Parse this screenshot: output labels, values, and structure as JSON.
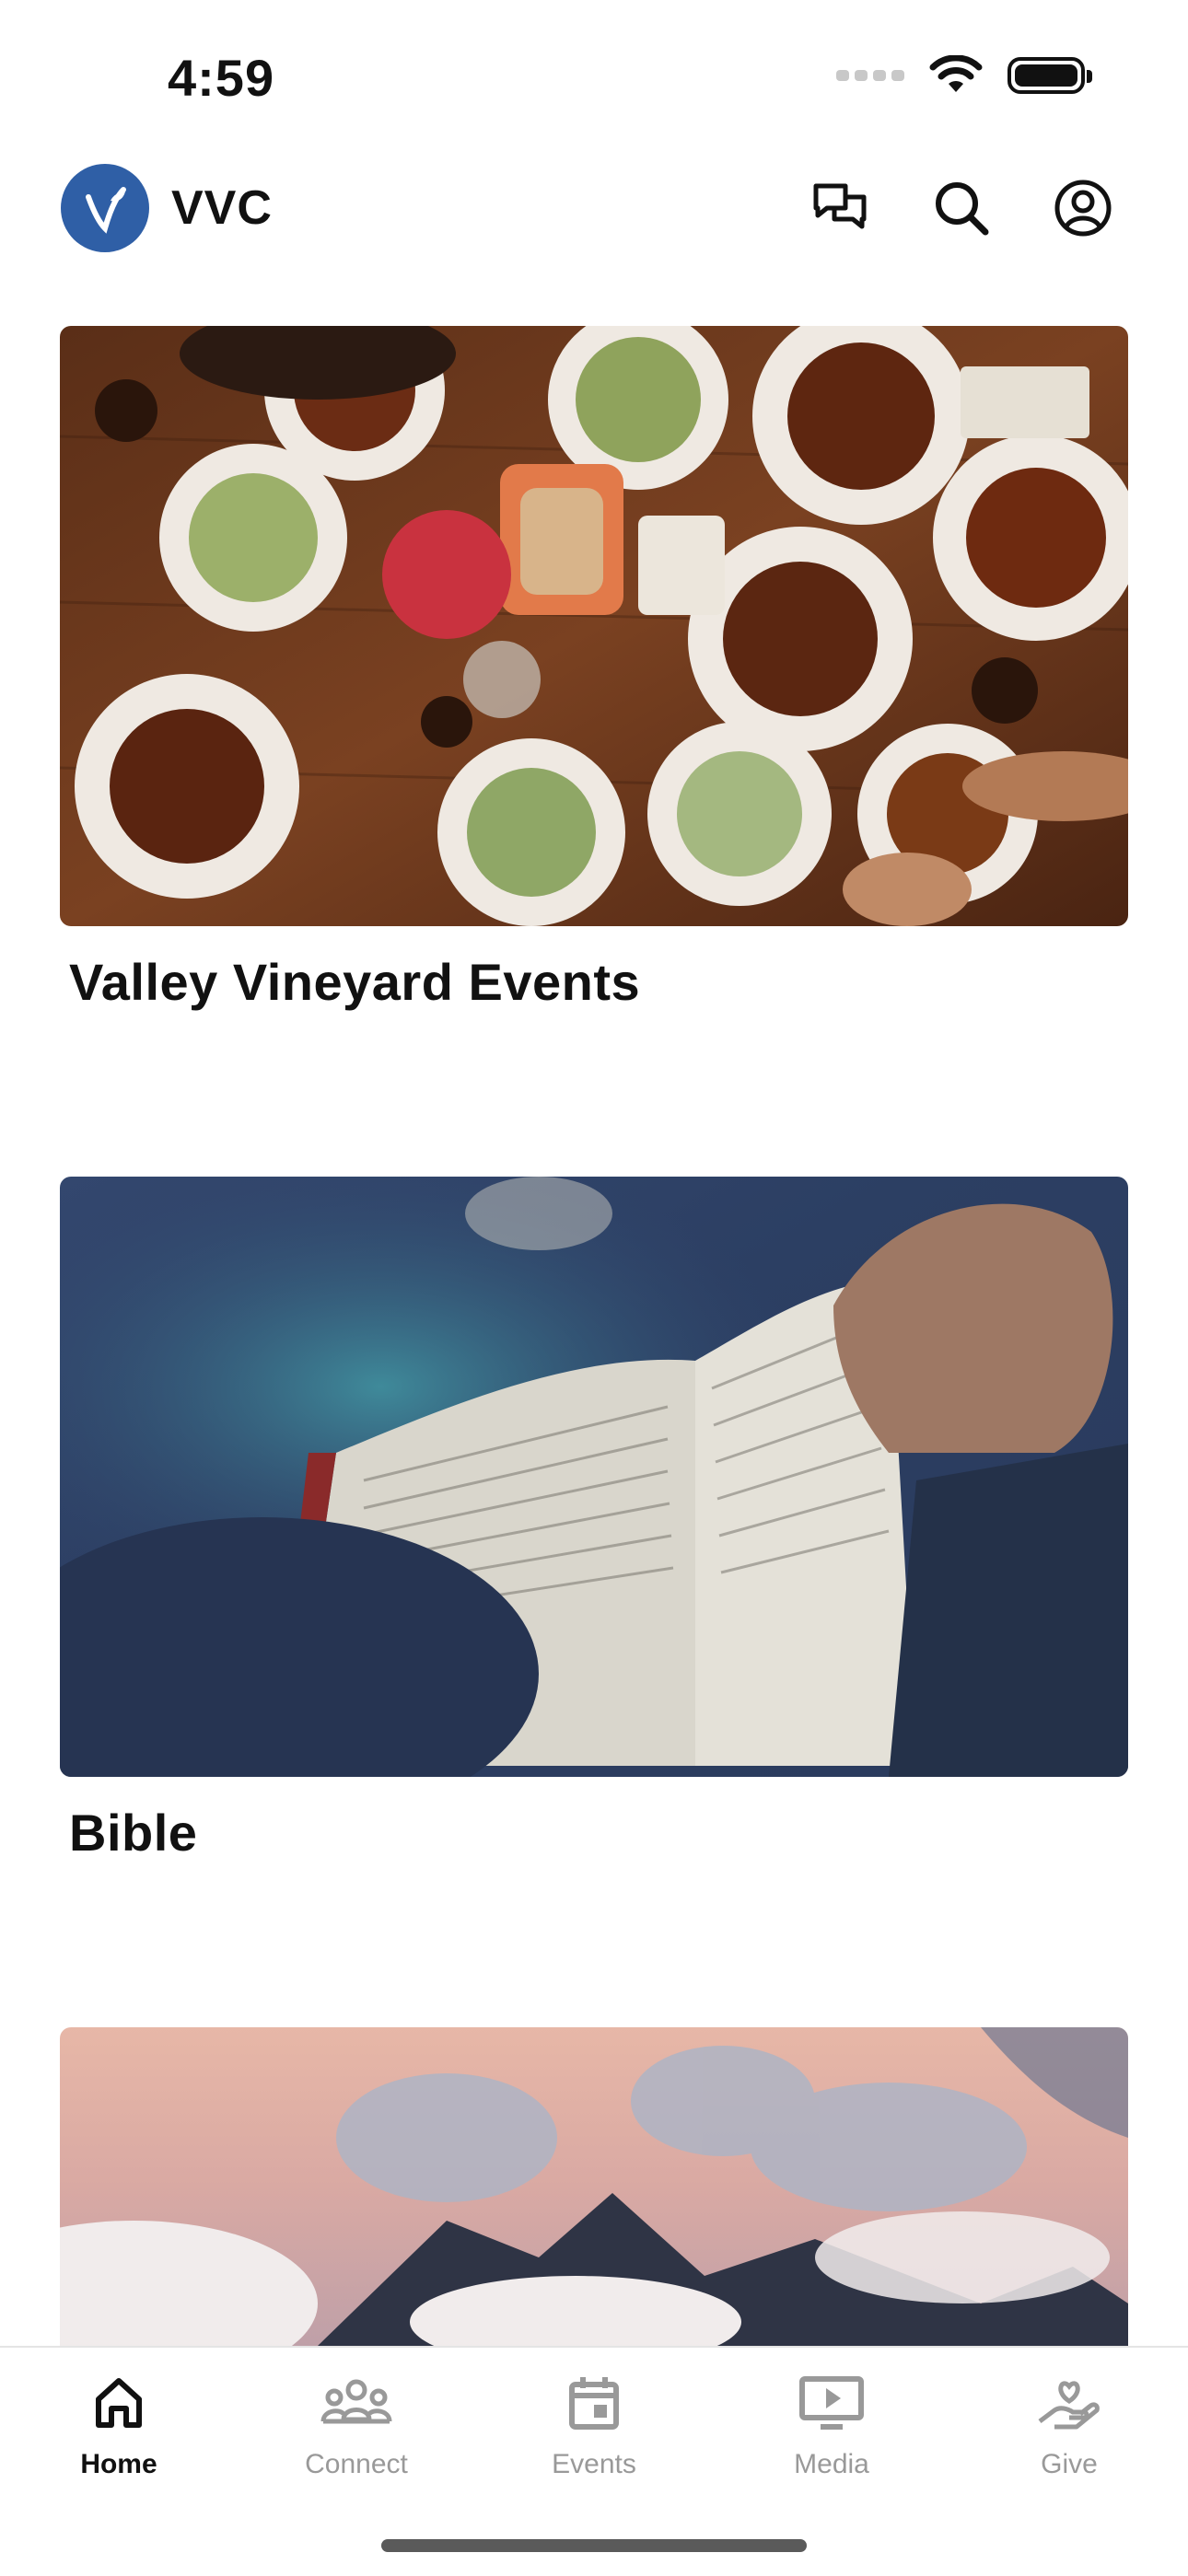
{
  "status_bar": {
    "time": "4:59"
  },
  "header": {
    "title": "VVC"
  },
  "cards": [
    {
      "title": "Valley Vineyard Events",
      "image": "shared-meal-table-photo"
    },
    {
      "title": "Bible",
      "image": "open-bible-photo"
    },
    {
      "title": "",
      "image": "mountains-above-clouds-photo"
    }
  ],
  "tabs": [
    {
      "label": "Home",
      "icon": "home-icon",
      "active": true
    },
    {
      "label": "Connect",
      "icon": "people-icon",
      "active": false
    },
    {
      "label": "Events",
      "icon": "calendar-icon",
      "active": false
    },
    {
      "label": "Media",
      "icon": "play-screen-icon",
      "active": false
    },
    {
      "label": "Give",
      "icon": "heart-hand-icon",
      "active": false
    }
  ],
  "colors": {
    "brand": "#2f5fa6",
    "inactive_tab": "#999999",
    "active_tab": "#111111"
  }
}
